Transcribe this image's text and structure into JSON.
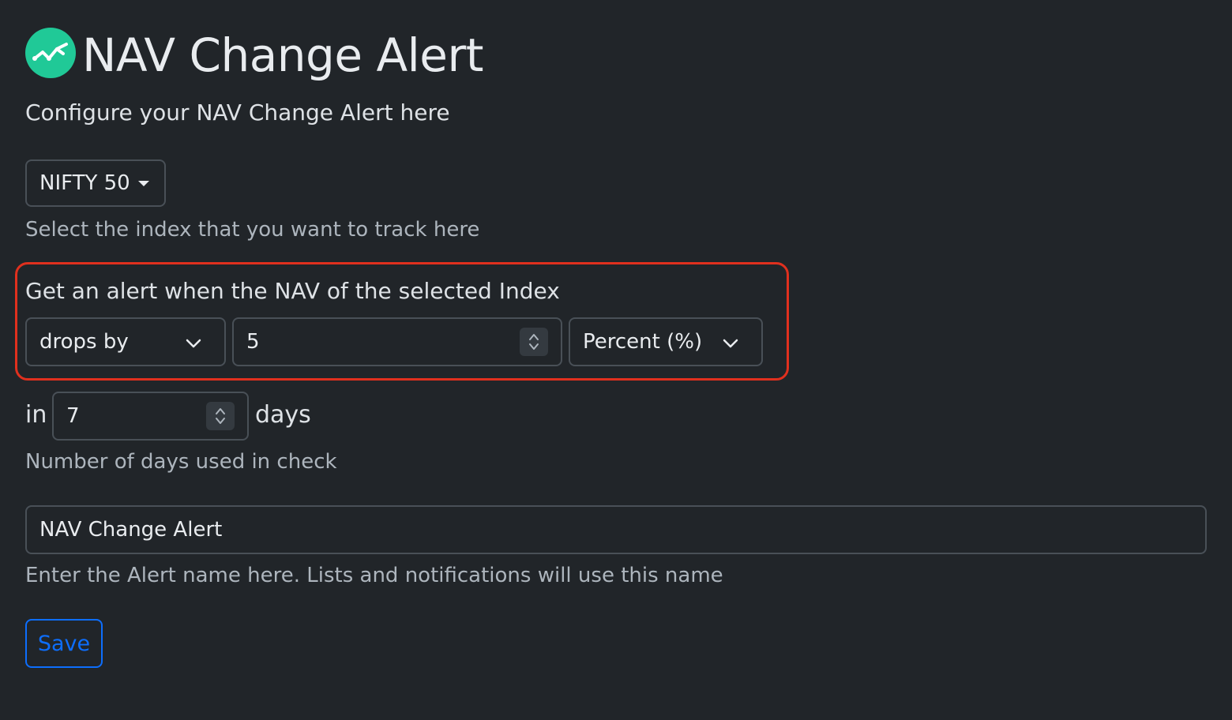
{
  "header": {
    "title": "NAV Change Alert",
    "logo_icon": "trend-chart-icon",
    "logo_color": "#20c997"
  },
  "subtitle": "Configure your NAV Change Alert here",
  "index_select": {
    "value": "NIFTY 50",
    "help": "Select the index that you want to track here"
  },
  "condition": {
    "label": "Get an alert when the NAV of the selected Index",
    "direction": "drops by",
    "amount": "5",
    "unit": "Percent (%)",
    "highlight_color": "#e0301e"
  },
  "window": {
    "prefix": "in",
    "value": "7",
    "suffix": "days",
    "help": "Number of days used in check"
  },
  "alert_name": {
    "value": "NAV Change Alert",
    "help": "Enter the Alert name here. Lists and notifications will use this name"
  },
  "save_label": "Save",
  "colors": {
    "background": "#212529",
    "primary": "#0d6efd",
    "border": "#495057"
  }
}
